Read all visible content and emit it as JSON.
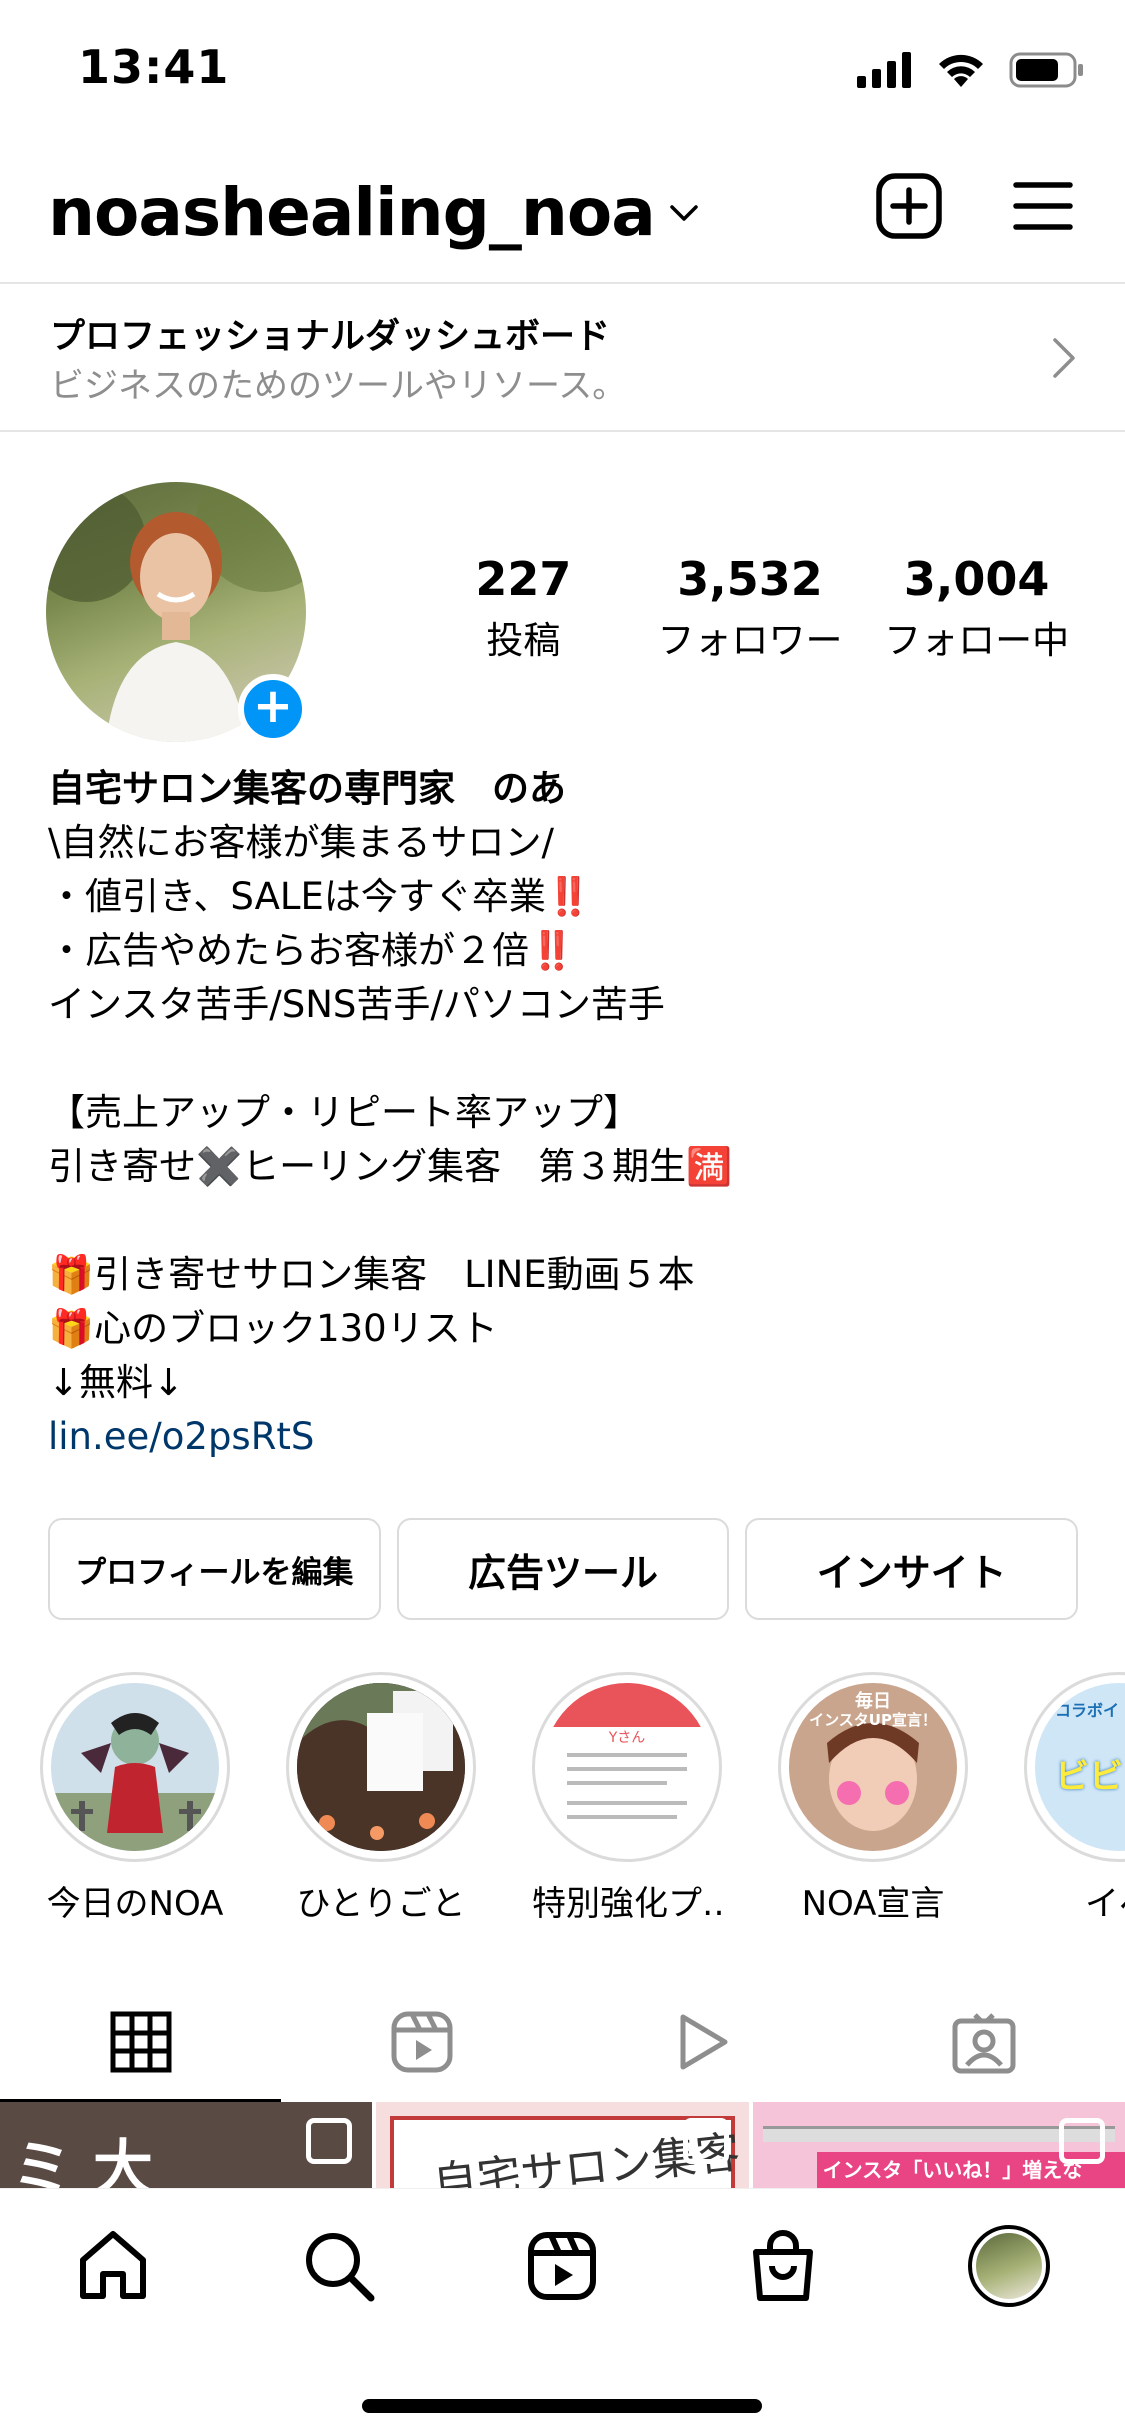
{
  "status_bar": {
    "time": "13:41"
  },
  "header": {
    "username": "noashealing_noa"
  },
  "dashboard": {
    "title": "プロフェッショナルダッシュボード",
    "subtitle": "ビジネスのためのツールやリソース。"
  },
  "stats": [
    {
      "value": "227",
      "label": "投稿"
    },
    {
      "value": "3,532",
      "label": "フォロワー"
    },
    {
      "value": "3,004",
      "label": "フォロー中"
    }
  ],
  "bio": {
    "name": "自宅サロン集客の専門家　のあ",
    "line1": "\\自然にお客様が集まるサロン/",
    "line2": "・値引き、SALEは今すぐ卒業‼️",
    "line3": "・広告やめたらお客様が２倍‼️",
    "line4": "インスタ苦手/SNS苦手/パソコン苦手",
    "line5": "【売上アップ・リピート率アップ】",
    "line6": "引き寄せ✖️ヒーリング集客　第３期生🈵",
    "line7": "🎁引き寄せサロン集客　LINE動画５本",
    "line8": "🎁心のブロック130リスト",
    "line9": "↓無料↓",
    "link": "lin.ee/o2psRtS"
  },
  "actions": {
    "edit_profile": "プロフィールを編集",
    "ad_tools": "広告ツール",
    "insights": "インサイト"
  },
  "highlights": [
    {
      "label": "今日のNOA"
    },
    {
      "label": "ひとりごと"
    },
    {
      "label": "特別強化プ…"
    },
    {
      "label": "NOA宣言"
    },
    {
      "label": "イベ"
    }
  ],
  "highlight_art": {
    "h3_top": "Yさん",
    "h4_top": "毎日",
    "h4_sub": "インスタUP宣言！",
    "h5_top": "コラボイ",
    "h5_big": "ビビ"
  },
  "grid": {
    "cell1_text": "ミ 大",
    "cell2_text": "自宅サロン集客",
    "cell3_text": "インスタ「いいね！」増えない…"
  },
  "colors": {
    "accent": "#0095f6",
    "link": "#00376b",
    "border": "#dbdbdb",
    "secondary_text": "#8e8e8e"
  }
}
